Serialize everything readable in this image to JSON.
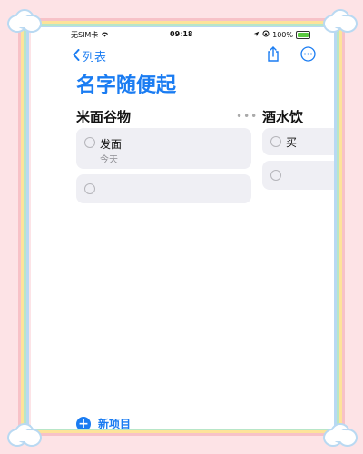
{
  "status_bar": {
    "carrier": "无SIM卡",
    "time": "09:18",
    "battery": "100%"
  },
  "nav": {
    "back_label": "列表"
  },
  "page_title": "名字随便起",
  "columns": [
    {
      "title": "米面谷物",
      "items": [
        {
          "title": "发面",
          "subtitle": "今天"
        }
      ]
    },
    {
      "title": "酒水饮",
      "items": [
        {
          "title": "买"
        }
      ]
    }
  ],
  "footer": {
    "new_item_label": "新项目"
  },
  "colors": {
    "accent": "#1a7cf2",
    "card": "#efeff4",
    "background": "#fde3e6"
  }
}
